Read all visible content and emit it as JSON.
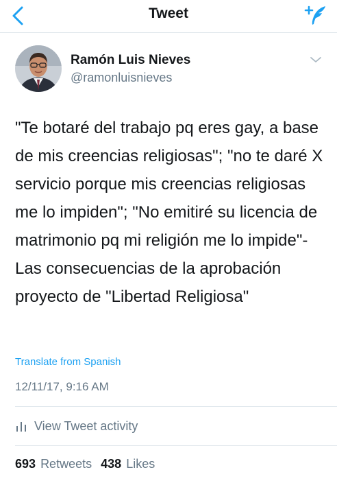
{
  "nav": {
    "title": "Tweet",
    "back_icon": "chevron-left-icon",
    "compose_icon": "compose-tweet-icon"
  },
  "author": {
    "name": "Ramón Luis Nieves",
    "handle": "@ramonluisnieves",
    "menu_icon": "chevron-down-icon"
  },
  "tweet": {
    "text": "\"Te botaré del trabajo pq eres gay, a base de mis creencias religiosas\"; \"no te daré X servicio porque mis creencias religiosas me lo impiden\"; \"No emitiré su licencia de matrimonio pq mi religión me lo impide\"- Las consecuencias de la aprobación proyecto de \"Libertad Religiosa\"",
    "translate_label": "Translate from Spanish",
    "timestamp": "12/11/17, 9:16 AM"
  },
  "activity": {
    "label": "View Tweet activity",
    "icon": "bar-chart-icon"
  },
  "stats": {
    "retweets_count": "693",
    "retweets_label": "Retweets",
    "likes_count": "438",
    "likes_label": "Likes"
  },
  "colors": {
    "accent": "#1da1f2",
    "text": "#14171a",
    "secondary": "#657786",
    "divider": "#e1e8ed"
  }
}
